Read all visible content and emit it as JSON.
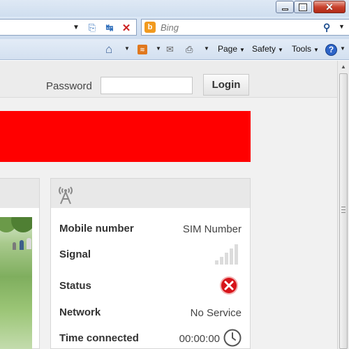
{
  "window": {
    "controls": [
      {
        "name": "minimize-button",
        "icon": "minimize-icon"
      },
      {
        "name": "restore-button",
        "icon": "restore-icon"
      },
      {
        "name": "close-button",
        "icon": "close-icon",
        "glyph": "✕"
      }
    ]
  },
  "address_bar": {
    "dropdown_glyph": "▼",
    "compat_glyph": "⎘",
    "refresh_glyph": "↹",
    "stop_glyph": "✕"
  },
  "search": {
    "placeholder": "Bing",
    "provider_glyph": "b",
    "go_glyph": "⚲",
    "dropdown_glyph": "▼"
  },
  "command_bar": {
    "home_glyph": "⌂",
    "feeds_glyph": "≋",
    "mail_glyph": "✉",
    "print_glyph": "⎙",
    "dropdown_glyph": "▼",
    "menus": [
      {
        "label": "Page"
      },
      {
        "label": "Safety"
      },
      {
        "label": "Tools"
      }
    ],
    "help_glyph": "?"
  },
  "login": {
    "password_label": "Password",
    "password_value": "",
    "login_button": "Login"
  },
  "colors": {
    "banner": "#ff0000",
    "error": "#d7141a"
  },
  "status_panel": {
    "header_icon": "antenna-icon",
    "rows": [
      {
        "label": "Mobile number",
        "value": "SIM Number"
      },
      {
        "label": "Signal",
        "icon": "signal-bars-icon",
        "signal_level": 0
      },
      {
        "label": "Status",
        "icon": "error-icon"
      },
      {
        "label": "Network",
        "value": "No Service"
      },
      {
        "label": "Time connected",
        "value": "00:00:00",
        "icon": "clock-icon"
      }
    ]
  },
  "scrollbar": {
    "up_glyph": "▲"
  }
}
